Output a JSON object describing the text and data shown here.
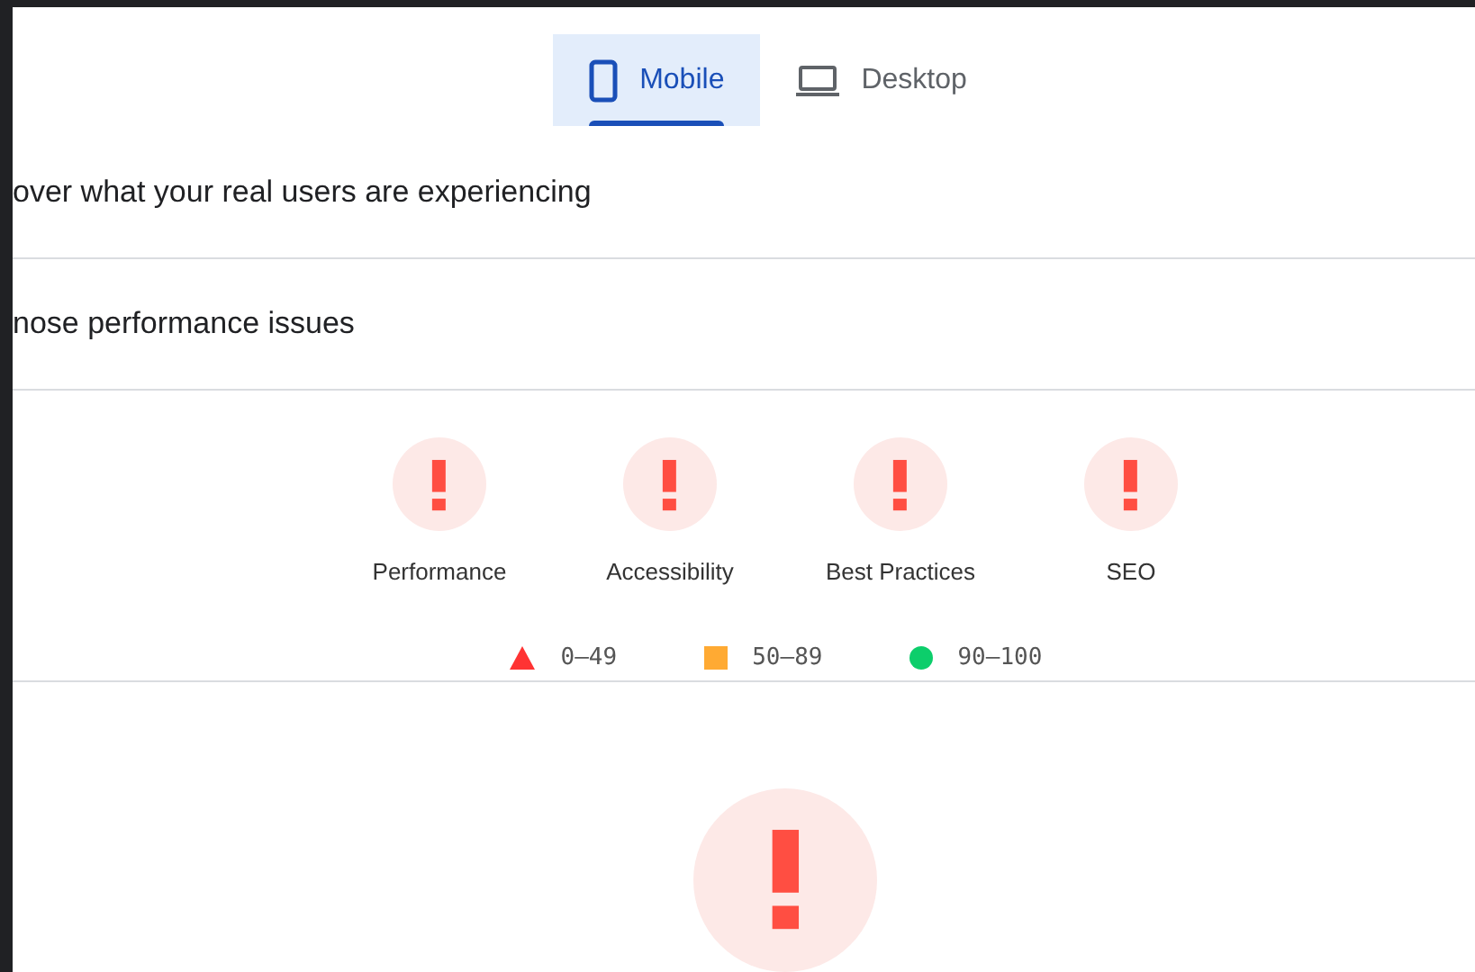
{
  "tabs": [
    {
      "label": "Mobile",
      "kind": "phone",
      "selected": true
    },
    {
      "label": "Desktop",
      "kind": "laptop",
      "selected": false
    }
  ],
  "sections": [
    {
      "title": "over what your real users are experiencing"
    },
    {
      "title": "nose performance issues"
    }
  ],
  "gauges": [
    {
      "label": "Performance"
    },
    {
      "label": "Accessibility"
    },
    {
      "label": "Best Practices"
    },
    {
      "label": "SEO"
    }
  ],
  "legend": [
    {
      "kind": "triangle",
      "color": "#ff3333",
      "range": "0–49"
    },
    {
      "kind": "square",
      "color": "#ffaa33",
      "range": "50–89"
    },
    {
      "kind": "circle",
      "color": "#0cce6b",
      "range": "90–100"
    }
  ]
}
